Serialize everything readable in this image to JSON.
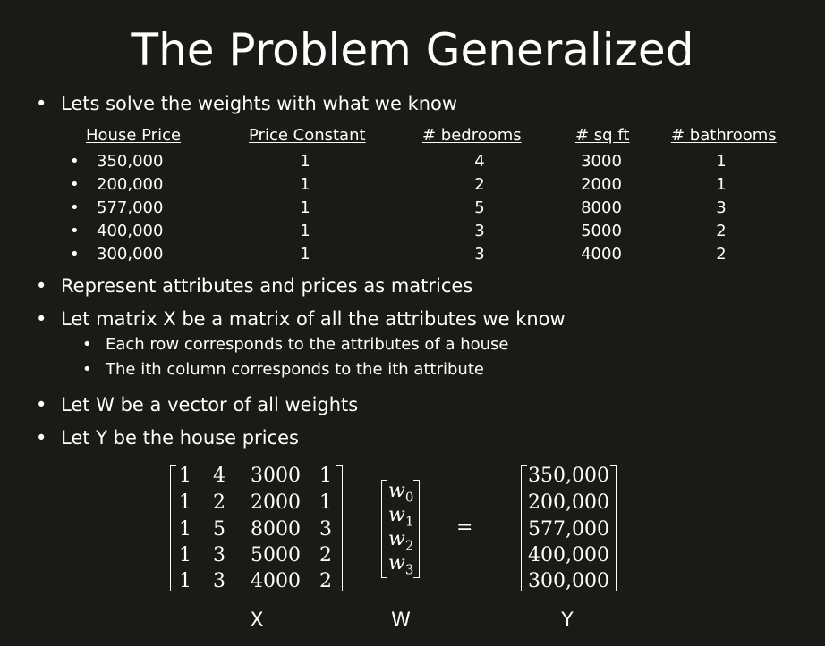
{
  "title": "The Problem Generalized",
  "bullets": {
    "b1": "Lets solve the weights with what we know",
    "b2": "Represent attributes and prices as matrices",
    "b3": "Let matrix X be a matrix of all the attributes we know",
    "b3_sub1": "Each row corresponds to the attributes of a house",
    "b3_sub2": "The ith column corresponds to the ith attribute",
    "b4": "Let W be a vector of all weights",
    "b5": "Let Y be the house prices"
  },
  "table": {
    "headers": [
      "House Price",
      "Price Constant",
      "# bedrooms",
      "# sq ft",
      "# bathrooms"
    ],
    "rows": [
      [
        "350,000",
        "1",
        "4",
        "3000",
        "1"
      ],
      [
        "200,000",
        "1",
        "2",
        "2000",
        "1"
      ],
      [
        "577,000",
        "1",
        "5",
        "8000",
        "3"
      ],
      [
        "400,000",
        "1",
        "3",
        "5000",
        "2"
      ],
      [
        "300,000",
        "1",
        "3",
        "4000",
        "2"
      ]
    ]
  },
  "equation": {
    "X": [
      [
        "1",
        "4",
        "3000",
        "1"
      ],
      [
        "1",
        "2",
        "2000",
        "1"
      ],
      [
        "1",
        "5",
        "8000",
        "3"
      ],
      [
        "1",
        "3",
        "5000",
        "2"
      ],
      [
        "1",
        "3",
        "4000",
        "2"
      ]
    ],
    "W": [
      "w0",
      "w1",
      "w2",
      "w3"
    ],
    "equals": "=",
    "Y": [
      "350,000",
      "200,000",
      "577,000",
      "400,000",
      "300,000"
    ],
    "labels": {
      "x": "X",
      "w": "W",
      "y": "Y"
    }
  }
}
